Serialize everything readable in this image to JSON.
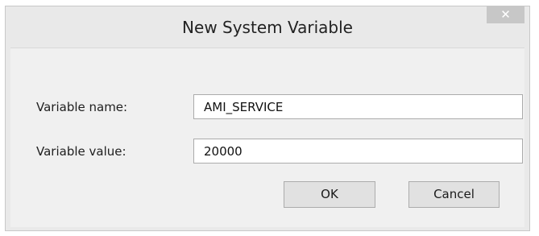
{
  "dialog": {
    "title": "New System Variable",
    "close_label": "✕"
  },
  "form": {
    "name_label": "Variable name:",
    "name_value": "AMI_SERVICE",
    "value_label": "Variable value:",
    "value_value": "20000"
  },
  "buttons": {
    "ok_label": "OK",
    "cancel_label": "Cancel"
  },
  "colors": {
    "frame": "#e9e9e9",
    "client": "#f0f0f0",
    "close_button": "#c7c7c7",
    "button_face": "#e1e1e1"
  }
}
